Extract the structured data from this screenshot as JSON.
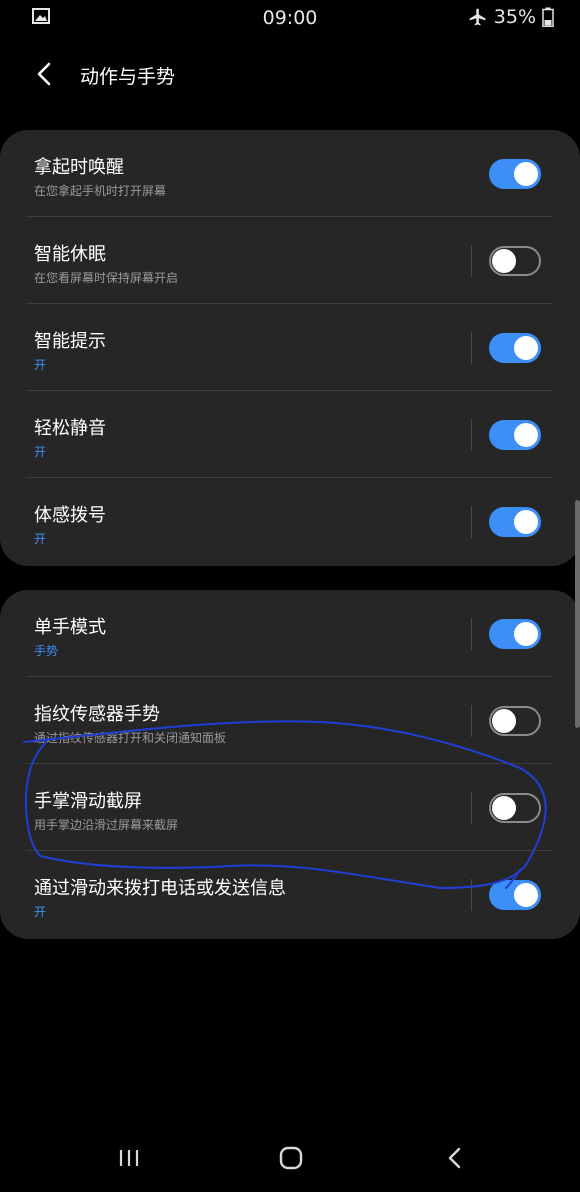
{
  "status_bar": {
    "time": "09:00",
    "battery": "35%",
    "icons": [
      "image-icon",
      "airplane-icon",
      "battery-icon"
    ]
  },
  "header": {
    "title": "动作与手势",
    "back_icon": "chevron-left-icon"
  },
  "cards": [
    {
      "items": [
        {
          "title": "拿起时唤醒",
          "subtitle": "在您拿起手机时打开屏幕",
          "subtitle_accent": false,
          "enabled": true
        },
        {
          "title": "智能休眠",
          "subtitle": "在您看屏幕时保持屏幕开启",
          "subtitle_accent": false,
          "enabled": false
        },
        {
          "title": "智能提示",
          "subtitle": "开",
          "subtitle_accent": true,
          "enabled": true
        },
        {
          "title": "轻松静音",
          "subtitle": "开",
          "subtitle_accent": true,
          "enabled": true
        },
        {
          "title": "体感拨号",
          "subtitle": "开",
          "subtitle_accent": true,
          "enabled": true
        }
      ]
    },
    {
      "items": [
        {
          "title": "单手模式",
          "subtitle": "手势",
          "subtitle_accent": true,
          "enabled": true
        },
        {
          "title": "指纹传感器手势",
          "subtitle": "通过指纹传感器打开和关闭通知面板",
          "subtitle_accent": false,
          "enabled": false
        },
        {
          "title": "手掌滑动截屏",
          "subtitle": "用手掌边沿滑过屏幕来截屏",
          "subtitle_accent": false,
          "enabled": false
        },
        {
          "title": "通过滑动来拨打电话或发送信息",
          "subtitle": "开",
          "subtitle_accent": true,
          "enabled": true
        }
      ]
    }
  ],
  "colors": {
    "background": "#000000",
    "card": "#262626",
    "accent": "#3e8ef7",
    "annotation": "#1f3fd6"
  },
  "nav_bar": {
    "icons": [
      "recents-icon",
      "home-icon",
      "back-icon"
    ]
  }
}
